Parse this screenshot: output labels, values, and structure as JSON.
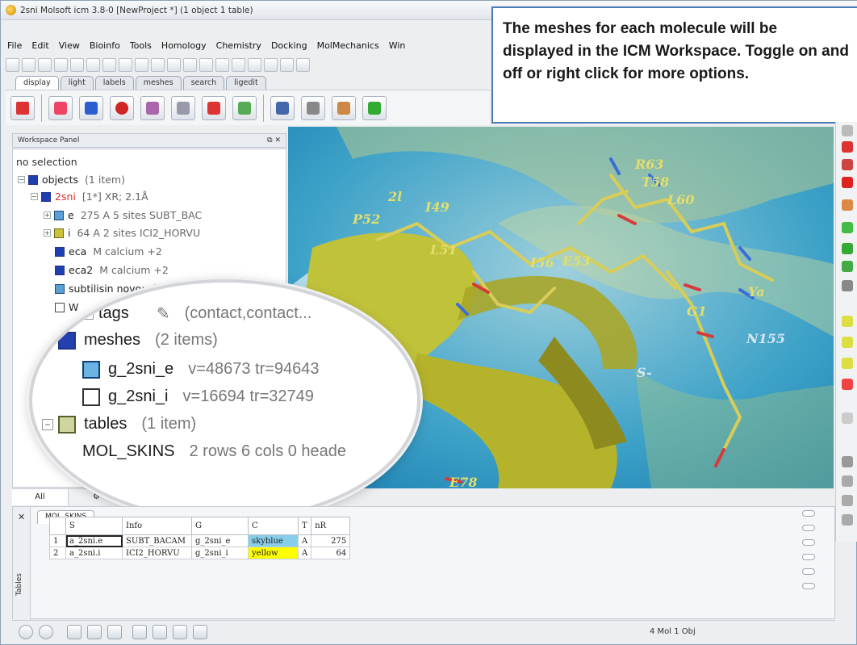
{
  "window": {
    "title": "2sni Molsoft icm 3.8-0  [NewProject *] (1 object 1 table)"
  },
  "menu": [
    "File",
    "Edit",
    "View",
    "Bioinfo",
    "Tools",
    "Homology",
    "Chemistry",
    "Docking",
    "MolMechanics",
    "Win"
  ],
  "tabs": [
    "display",
    "light",
    "labels",
    "meshes",
    "search",
    "ligedit"
  ],
  "callout": {
    "text": "The meshes for each molecule will be displayed in the ICM Workspace. Toggle on and off or right click for more options."
  },
  "workspace": {
    "title": "Workspace Panel",
    "selection": "no selection",
    "tree": {
      "objects": {
        "label": "objects",
        "count": "(1 item)"
      },
      "obj_2sni": {
        "label": "2sni",
        "desc": "[1*] XR; 2.1Å"
      },
      "e": {
        "label": "e",
        "desc": "275 A  5 sites SUBT_BAC"
      },
      "i": {
        "label": "i",
        "desc": "64 A  2 sites ICI2_HORVU"
      },
      "eca": {
        "label": "eca",
        "desc": "M   calcium +2"
      },
      "eca2": {
        "label": "eca2",
        "desc": "M   calcium +2"
      },
      "subtilisin": {
        "label": "subtilisin novo; chain: e; ec: 3.4."
      },
      "w": {
        "label": "W"
      }
    },
    "bottom_tabs": [
      "All",
      "⚙"
    ]
  },
  "magnifier": {
    "tags": {
      "label": "tags",
      "desc": "(contact,contact..."
    },
    "meshes": {
      "label": "meshes",
      "count": "(2 items)"
    },
    "mesh1": {
      "label": "g_2sni_e",
      "desc": "v=48673 tr=94643"
    },
    "mesh2": {
      "label": "g_2sni_i",
      "desc": "v=16694 tr=32749"
    },
    "tables": {
      "label": "tables",
      "count": "(1 item)"
    },
    "mol_skins": {
      "label": "MOL_SKINS",
      "desc": "2 rows 6 cols 0 heade"
    }
  },
  "viewport": {
    "labels": [
      "2l",
      "P52",
      "I49",
      "L51",
      "I56",
      "E53",
      "R63",
      "T58",
      "L60",
      "G1",
      "N155",
      "E78",
      "S-",
      "Ya"
    ]
  },
  "table_panel": {
    "tab": "MOL_SKINS",
    "side_title": "Tables",
    "columns": [
      "",
      "S",
      "Info",
      "G",
      "C",
      "T",
      "nR"
    ],
    "rows": [
      [
        "1",
        "a_2sni.e",
        "SUBT_BACAM",
        "g_2sni_e",
        "skyblue",
        "A",
        "275"
      ],
      [
        "2",
        "a_2sni.i",
        "ICI2_HORVU",
        "g_2sni_i",
        "yellow",
        "A",
        "64"
      ]
    ]
  },
  "status": {
    "text": "4 Mol 1 Obj"
  },
  "colors": {
    "skyblue": "#87ceeb",
    "yellow": "#ffff00",
    "callout_border": "#4a78b5",
    "accent_red": "#d63030"
  }
}
